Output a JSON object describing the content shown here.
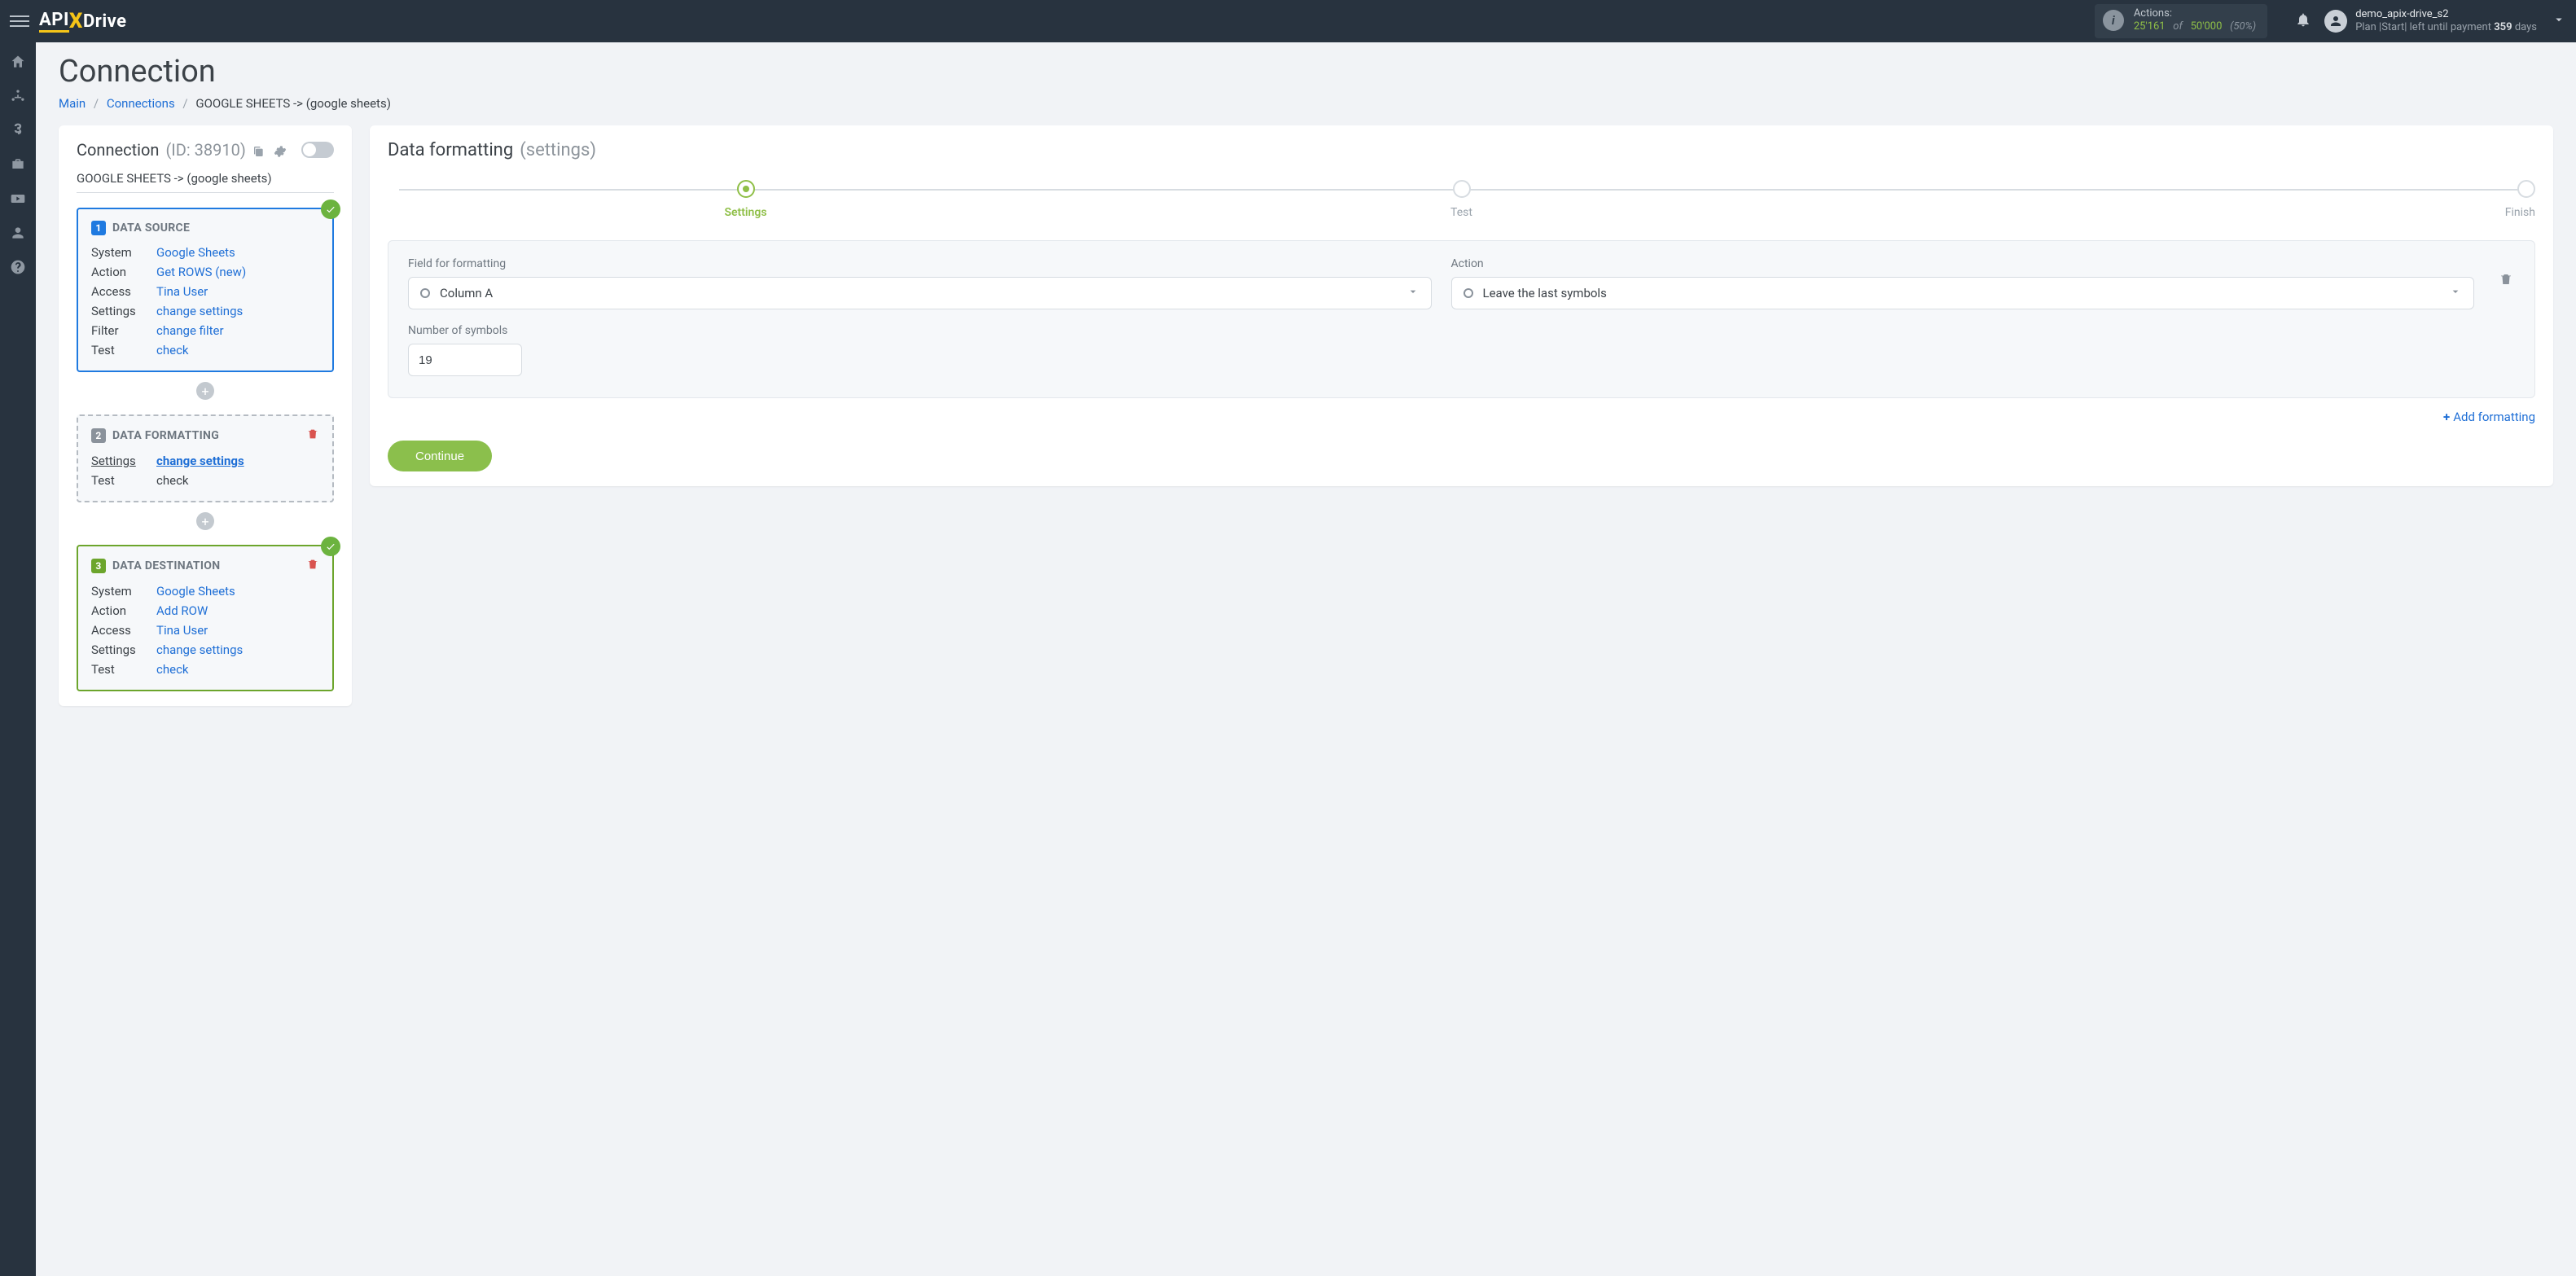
{
  "topbar": {
    "logo": {
      "part1": "API",
      "x": "X",
      "part2": "Drive"
    },
    "actions": {
      "label": "Actions:",
      "count": "25'161",
      "of": "of",
      "limit": "50'000",
      "pct": "(50%)"
    },
    "user": {
      "name": "demo_apix-drive_s2",
      "plan_prefix": "Plan |Start| left until payment ",
      "days_num": "359",
      "days_word": " days"
    }
  },
  "page": {
    "title": "Connection",
    "breadcrumb": {
      "main": "Main",
      "connections": "Connections",
      "current": "GOOGLE SHEETS -> (google sheets)"
    }
  },
  "connection": {
    "label": "Connection",
    "id_label": "(ID: 38910)",
    "subtitle": "GOOGLE SHEETS -> (google sheets)",
    "source": {
      "title": "DATA SOURCE",
      "rows": {
        "system_k": "System",
        "system_v": "Google Sheets",
        "action_k": "Action",
        "action_v": "Get ROWS (new)",
        "access_k": "Access",
        "access_v": "Tina User",
        "settings_k": "Settings",
        "settings_v": "change settings",
        "filter_k": "Filter",
        "filter_v": "change filter",
        "test_k": "Test",
        "test_v": "check"
      }
    },
    "format": {
      "title": "DATA FORMATTING",
      "rows": {
        "settings_k": "Settings",
        "settings_v": "change settings",
        "test_k": "Test",
        "test_v": "check"
      }
    },
    "dest": {
      "title": "DATA DESTINATION",
      "rows": {
        "system_k": "System",
        "system_v": "Google Sheets",
        "action_k": "Action",
        "action_v": "Add ROW",
        "access_k": "Access",
        "access_v": "Tina User",
        "settings_k": "Settings",
        "settings_v": "change settings",
        "test_k": "Test",
        "test_v": "check"
      }
    }
  },
  "panel": {
    "title": "Data formatting",
    "title_dim": "(settings)",
    "wizard": {
      "s1": "Settings",
      "s2": "Test",
      "s3": "Finish"
    },
    "form": {
      "field_label": "Field for formatting",
      "field_value": "Column A",
      "action_label": "Action",
      "action_value": "Leave the last symbols",
      "num_label": "Number of symbols",
      "num_value": "19",
      "add_label": "Add formatting",
      "continue": "Continue"
    }
  }
}
